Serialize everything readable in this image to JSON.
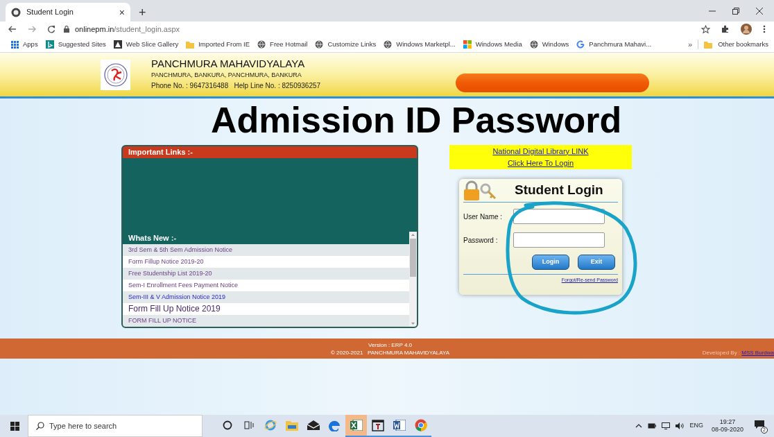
{
  "browser": {
    "tab": {
      "title": "Student Login",
      "close": "×",
      "selected": true
    },
    "new_tab": "+",
    "url_host": "onlinepm.in",
    "url_path": "/student_login.aspx",
    "bookmarks": [
      {
        "label": "Apps",
        "kind": "apps"
      },
      {
        "label": "Suggested Sites",
        "kind": "bing"
      },
      {
        "label": "Web Slice Gallery",
        "kind": "slice"
      },
      {
        "label": "Imported From IE",
        "kind": "folder"
      },
      {
        "label": "Free Hotmail",
        "kind": "globe"
      },
      {
        "label": "Customize Links",
        "kind": "globe"
      },
      {
        "label": "Windows Marketpl...",
        "kind": "globe"
      },
      {
        "label": "Windows Media",
        "kind": "windows"
      },
      {
        "label": "Windows",
        "kind": "globe"
      },
      {
        "label": "Panchmura Mahavi...",
        "kind": "google"
      }
    ],
    "overflow": "»",
    "other_bookmarks": "Other bookmarks"
  },
  "header": {
    "college": "PANCHMURA MAHAVIDYALAYA",
    "address": "PANCHMURA, BANKURA, PANCHMURA, BANKURA",
    "contact": "Phone No. : 9647316488   Help Line No. : 8250936257"
  },
  "page_title": "Admission ID Password",
  "important_links": {
    "title": "Important Links :-"
  },
  "whats_new": {
    "title": "Whats New :-",
    "items": [
      {
        "label": "3rd Sem & 5th Sem Admission Notice",
        "kind": "visited"
      },
      {
        "label": "Form Fillup Notice 2019-20",
        "kind": "visited"
      },
      {
        "label": "Free Studentship List 2019-20",
        "kind": "visited"
      },
      {
        "label": "Sem-I Enrollment Fees Payment Notice",
        "kind": "visited"
      },
      {
        "label": "Sem-III & V Admission Notice 2019",
        "kind": "link"
      },
      {
        "label": "Form Fill Up Notice 2019",
        "kind": "large"
      },
      {
        "label": "FORM FILL UP NOTICE",
        "kind": "visited"
      }
    ]
  },
  "library": {
    "links": [
      "National Digital Library LINK",
      "Click Here To Login"
    ]
  },
  "login": {
    "title": "Student Login",
    "fields": [
      {
        "label": "User Name :"
      },
      {
        "label": "Password :"
      }
    ],
    "buttons": [
      "Login",
      "Exit"
    ],
    "forgot": "Forgot/Re-send Password"
  },
  "footer": {
    "version": "Version : ERP 4.0",
    "copyright": "© 2020-2021   PANCHMURA MAHAVIDYALAYA",
    "developed_by": "Developed By : ",
    "developer": "MSS Burdwa"
  },
  "taskbar": {
    "search_placeholder": "Type here to search",
    "apps": [
      {
        "kind": "cortana",
        "running": false,
        "selected": false
      },
      {
        "kind": "taskview",
        "running": false,
        "selected": false
      },
      {
        "kind": "ie",
        "running": false,
        "selected": false
      },
      {
        "kind": "explorer",
        "running": false,
        "selected": false
      },
      {
        "kind": "mail",
        "running": false,
        "selected": false
      },
      {
        "kind": "edge",
        "running": false,
        "selected": false
      },
      {
        "kind": "excel",
        "running": true,
        "selected": true
      },
      {
        "kind": "app",
        "running": true,
        "selected": false
      },
      {
        "kind": "word",
        "running": true,
        "selected": false
      },
      {
        "kind": "chrome",
        "running": true,
        "selected": false
      }
    ],
    "language": "ENG",
    "time": "19:27",
    "date": "08-09-2020",
    "notifications": "2"
  }
}
